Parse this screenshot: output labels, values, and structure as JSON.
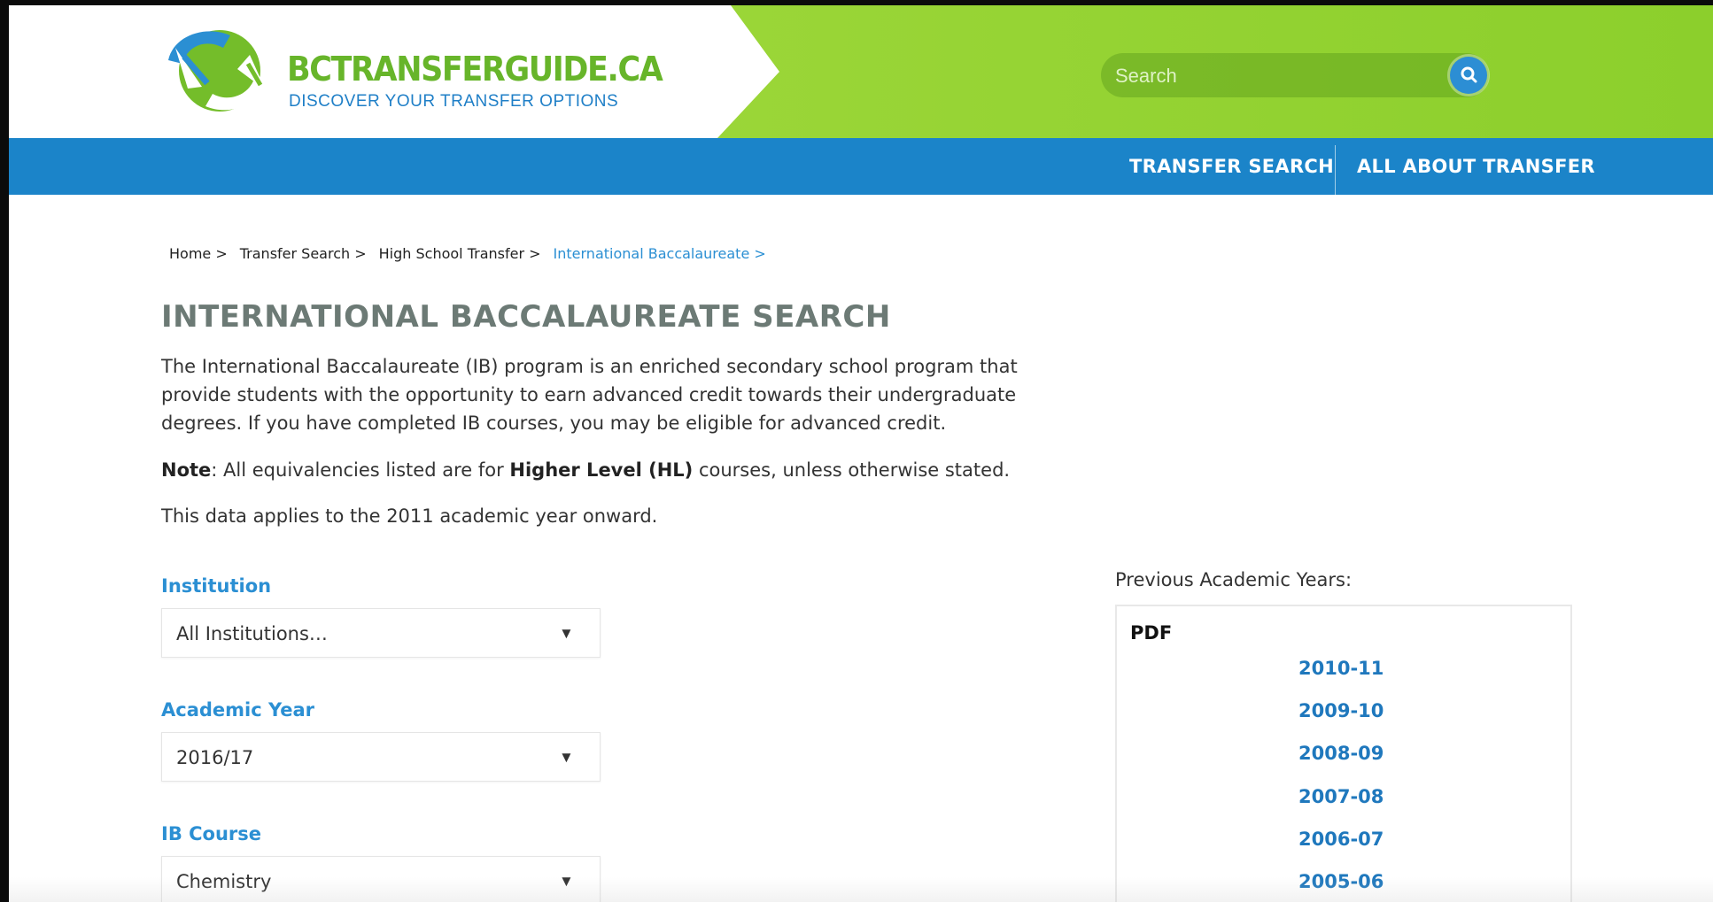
{
  "header": {
    "logo_title": "BCTRANSFERGUIDE.CA",
    "logo_tagline": "DISCOVER YOUR TRANSFER OPTIONS",
    "search_placeholder": "Search",
    "colors": {
      "green": "#8ccf2c",
      "blue": "#1b84c9",
      "white": "#ffffff"
    }
  },
  "nav": {
    "items": [
      {
        "label": "TRANSFER SEARCH"
      },
      {
        "label": "ALL ABOUT TRANSFER"
      }
    ]
  },
  "breadcrumb": [
    {
      "label": "Home >"
    },
    {
      "label": "Transfer Search >"
    },
    {
      "label": "High School Transfer >"
    },
    {
      "label": "International Baccalaureate >"
    }
  ],
  "main": {
    "title": "INTERNATIONAL BACCALAUREATE SEARCH",
    "intro": "The International Baccalaureate (IB) program is an enriched secondary school program that provide students with the opportunity to earn advanced credit towards their undergraduate degrees.  If you have completed IB courses, you may be eligible for advanced credit.",
    "note_label": "Note",
    "note_pre": ": All equivalencies listed are for ",
    "note_bold": "Higher Level (HL)",
    "note_post": " courses, unless otherwise stated.",
    "applies": "This data applies to the 2011 academic year onward."
  },
  "form": {
    "institution": {
      "label": "Institution",
      "value": "All Institutions…"
    },
    "academic_year": {
      "label": "Academic Year",
      "value": "2016/17"
    },
    "ib_course": {
      "label": "IB Course",
      "value": "Chemistry"
    }
  },
  "previous_years": {
    "label": "Previous Academic Years:",
    "heading": "PDF",
    "links": [
      "2010-11",
      "2009-10",
      "2008-09",
      "2007-08",
      "2006-07",
      "2005-06"
    ]
  }
}
